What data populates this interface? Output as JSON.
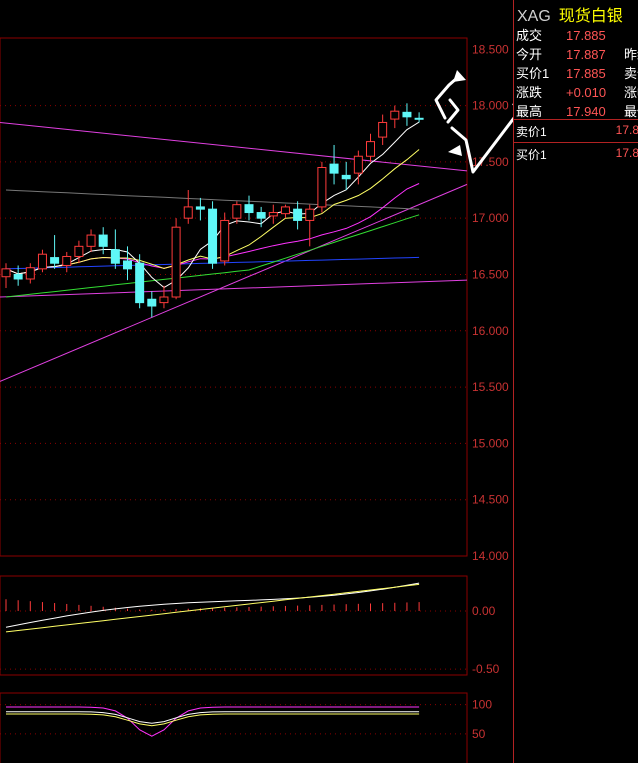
{
  "quote_panel": {
    "symbol": "XAG",
    "name": "现货白银",
    "rows": [
      {
        "label": "成交",
        "value": "17.885",
        "tail": ""
      },
      {
        "label": "今开",
        "value": "17.887",
        "tail": "昨结"
      },
      {
        "label": "买价1",
        "value": "17.885",
        "tail": "卖价"
      },
      {
        "label": "涨跌",
        "value": "+0.010",
        "tail": "涨幅"
      },
      {
        "label": "最高",
        "value": "17.940",
        "tail": "最低"
      }
    ],
    "order_book": [
      {
        "label": "卖价1",
        "value": "17.8"
      },
      {
        "label": "买价1",
        "value": "17.8"
      }
    ]
  },
  "colors": {
    "up": "#ff3b3b",
    "down": "#5ff7f7",
    "grid": "#8b0000",
    "axis_text": "#c83232",
    "ma5": "#ffffff",
    "ma10": "#ffff66",
    "ma20": "#ff33ff",
    "ma40": "#33dd33",
    "ma60": "#777777",
    "ma120": "#2244ff",
    "trendline": "#e040e0",
    "arrow": "#ffffff"
  },
  "chart_data": [
    {
      "type": "candlestick",
      "ylim": [
        14.0,
        18.6
      ],
      "y_ticks": [
        "18.500",
        "18.000",
        "17.500",
        "17.000",
        "16.500",
        "16.000",
        "15.500",
        "15.000",
        "14.500",
        "14.000"
      ],
      "candles": [
        {
          "o": 16.48,
          "h": 16.6,
          "c": 16.55,
          "l": 16.38
        },
        {
          "o": 16.5,
          "h": 16.58,
          "c": 16.46,
          "l": 16.4
        },
        {
          "o": 16.46,
          "h": 16.6,
          "c": 16.56,
          "l": 16.42
        },
        {
          "o": 16.55,
          "h": 16.72,
          "c": 16.68,
          "l": 16.52
        },
        {
          "o": 16.65,
          "h": 16.85,
          "c": 16.6,
          "l": 16.55
        },
        {
          "o": 16.58,
          "h": 16.7,
          "c": 16.66,
          "l": 16.52
        },
        {
          "o": 16.66,
          "h": 16.8,
          "c": 16.75,
          "l": 16.6
        },
        {
          "o": 16.75,
          "h": 16.9,
          "c": 16.85,
          "l": 16.7
        },
        {
          "o": 16.85,
          "h": 16.92,
          "c": 16.75,
          "l": 16.68
        },
        {
          "o": 16.72,
          "h": 16.9,
          "c": 16.6,
          "l": 16.55
        },
        {
          "o": 16.62,
          "h": 16.75,
          "c": 16.55,
          "l": 16.45
        },
        {
          "o": 16.6,
          "h": 16.68,
          "c": 16.25,
          "l": 16.2
        },
        {
          "o": 16.28,
          "h": 16.35,
          "c": 16.22,
          "l": 16.12
        },
        {
          "o": 16.25,
          "h": 16.4,
          "c": 16.3,
          "l": 16.2
        },
        {
          "o": 16.3,
          "h": 17.0,
          "c": 16.92,
          "l": 16.28
        },
        {
          "o": 17.0,
          "h": 17.25,
          "c": 17.1,
          "l": 16.95
        },
        {
          "o": 17.1,
          "h": 17.18,
          "c": 17.08,
          "l": 16.98
        },
        {
          "o": 17.08,
          "h": 17.15,
          "c": 16.6,
          "l": 16.55
        },
        {
          "o": 16.62,
          "h": 17.05,
          "c": 16.98,
          "l": 16.58
        },
        {
          "o": 17.0,
          "h": 17.15,
          "c": 17.12,
          "l": 16.95
        },
        {
          "o": 17.12,
          "h": 17.2,
          "c": 17.05,
          "l": 16.98
        },
        {
          "o": 17.05,
          "h": 17.1,
          "c": 17.0,
          "l": 16.92
        },
        {
          "o": 17.02,
          "h": 17.12,
          "c": 17.05,
          "l": 16.95
        },
        {
          "o": 17.04,
          "h": 17.12,
          "c": 17.1,
          "l": 17.0
        },
        {
          "o": 17.08,
          "h": 17.15,
          "c": 16.98,
          "l": 16.9
        },
        {
          "o": 16.98,
          "h": 17.12,
          "c": 17.08,
          "l": 16.75
        },
        {
          "o": 17.1,
          "h": 17.5,
          "c": 17.45,
          "l": 17.05
        },
        {
          "o": 17.48,
          "h": 17.65,
          "c": 17.4,
          "l": 17.3
        },
        {
          "o": 17.38,
          "h": 17.5,
          "c": 17.35,
          "l": 17.25
        },
        {
          "o": 17.4,
          "h": 17.6,
          "c": 17.55,
          "l": 17.3
        },
        {
          "o": 17.55,
          "h": 17.75,
          "c": 17.68,
          "l": 17.5
        },
        {
          "o": 17.72,
          "h": 17.92,
          "c": 17.85,
          "l": 17.65
        },
        {
          "o": 17.88,
          "h": 18.0,
          "c": 17.95,
          "l": 17.8
        },
        {
          "o": 17.94,
          "h": 18.02,
          "c": 17.9,
          "l": 17.82
        },
        {
          "o": 17.887,
          "h": 17.94,
          "c": 17.885,
          "l": 17.85
        }
      ]
    },
    {
      "type": "bar+line",
      "y_ticks": [
        "0.00",
        "-0.50"
      ],
      "ylim": [
        -0.55,
        0.3
      ]
    },
    {
      "type": "line",
      "y_ticks": [
        "100",
        "50"
      ],
      "ylim": [
        0,
        120
      ]
    }
  ]
}
